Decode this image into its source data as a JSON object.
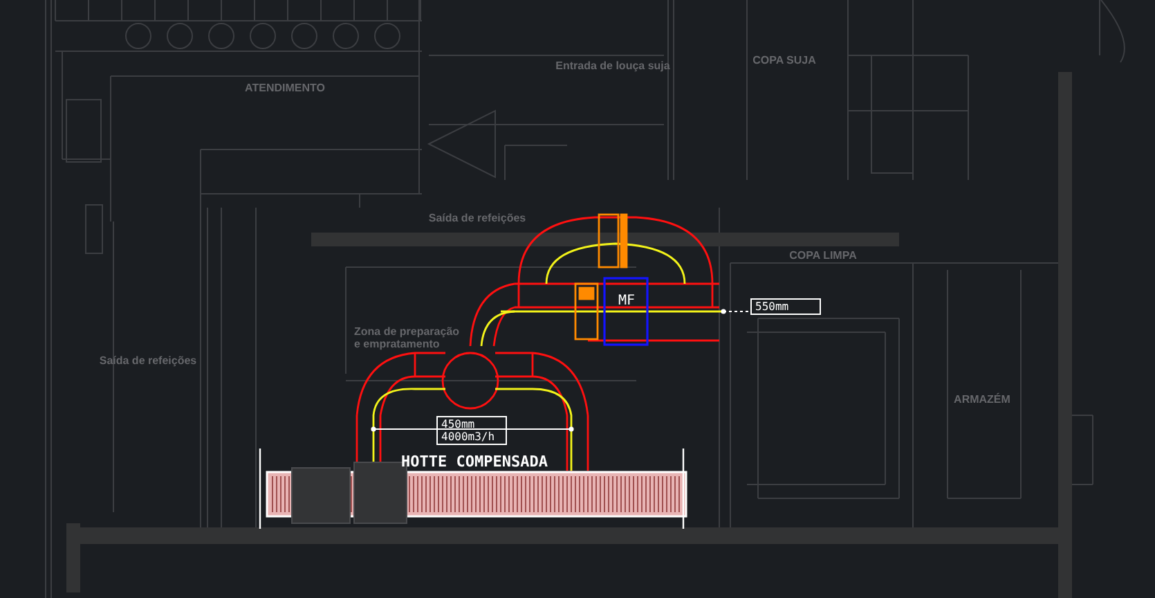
{
  "drawing": {
    "room_labels": [
      {
        "text": "ATENDIMENTO"
      },
      {
        "text": "Entrada de louça suja"
      },
      {
        "text": "COPA SUJA"
      },
      {
        "text": "Saída de refeições"
      },
      {
        "text": "COPA LIMPA"
      },
      {
        "text": "Saída de refeições"
      },
      {
        "text": "Zona de preparação"
      },
      {
        "text": "e empratamento"
      },
      {
        "text": "ARMAZÉM"
      }
    ],
    "fan_label": "MF",
    "duct_tags": [
      {
        "size": "450mm",
        "flow": "4000m3/h"
      },
      {
        "size": "550mm"
      }
    ],
    "hood_label": "HOTTE COMPENSADA"
  }
}
